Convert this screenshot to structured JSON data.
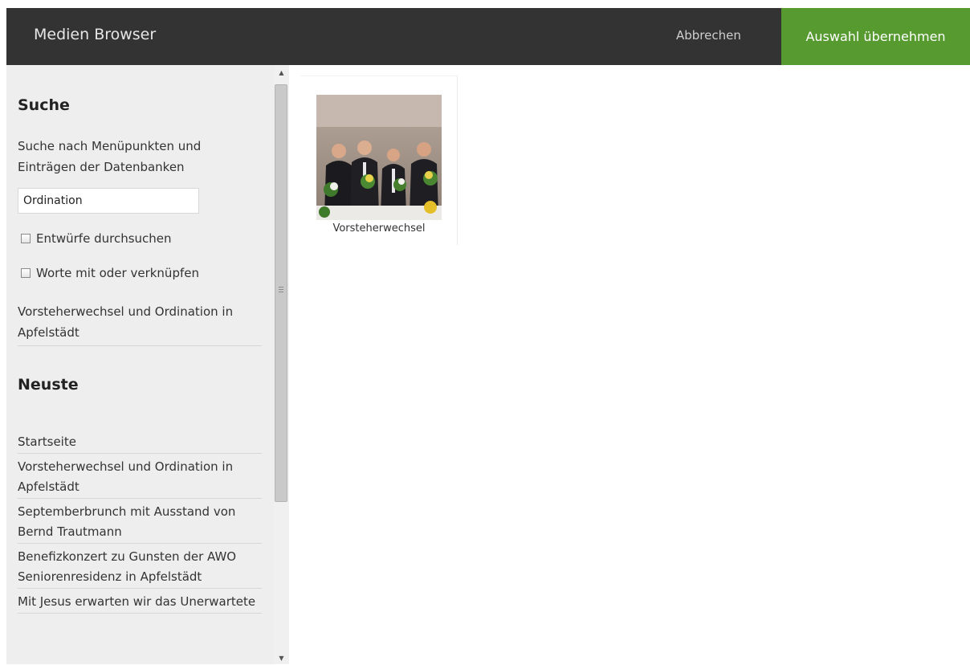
{
  "header": {
    "title": "Medien Browser",
    "cancel_label": "Abbrechen",
    "apply_label": "Auswahl übernehmen",
    "apply_color": "#569a30"
  },
  "sidebar": {
    "search_heading": "Suche",
    "search_description": "Suche nach Menüpunkten und Einträgen der Datenbanken",
    "search_value": "Ordination",
    "options": [
      {
        "label": "Entwürfe durchsuchen",
        "checked": false
      },
      {
        "label": "Worte mit oder verknüpfen",
        "checked": false
      }
    ],
    "search_result": "Vorsteherwechsel und Ordination in Apfelstädt",
    "recent_heading": "Neuste",
    "recent_items": [
      "Startseite",
      "Vorsteherwechsel und Ordination in Apfelstädt",
      "Septemberbrunch mit Ausstand von Bernd Trautmann",
      "Benefizkonzert zu Gunsten der AWO Seniorenresidenz in Apfelstädt",
      "Mit Jesus erwarten wir das Unerwartete"
    ]
  },
  "media": [
    {
      "caption": "Vorsteherwechsel"
    }
  ]
}
